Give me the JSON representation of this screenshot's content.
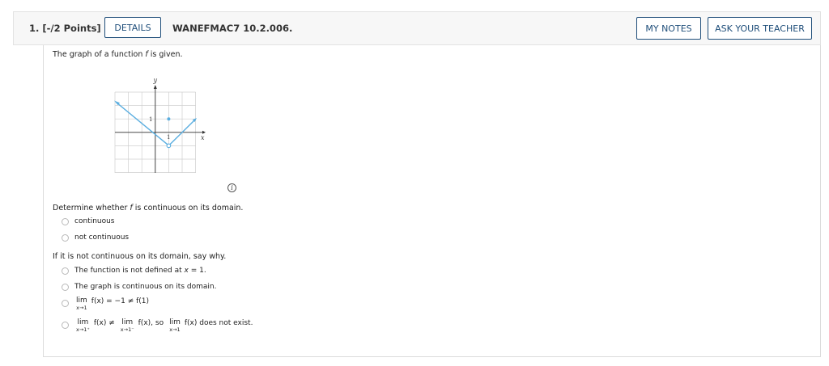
{
  "header": {
    "question_number": "1.  [-/2 Points]",
    "details_label": "DETAILS",
    "question_id": "WANEFMAC7 10.2.006.",
    "my_notes_label": "MY NOTES",
    "ask_teacher_label": "ASK YOUR TEACHER"
  },
  "prompt": {
    "before_f": "The graph of a function ",
    "f": "f",
    "after_f": " is given."
  },
  "graph": {
    "y_axis_label": "y",
    "x_axis_label": "x",
    "tick_y": "1",
    "tick_x": "1",
    "line_color": "#5aaee0"
  },
  "question1": {
    "before_f": "Determine whether ",
    "f": "f",
    "after_f": " is continuous on its domain.",
    "options": [
      "continuous",
      "not continuous"
    ]
  },
  "question2": {
    "text": "If it is not continuous on its domain, say why.",
    "opt1_pre": "The function is not defined at ",
    "opt1_x": "x",
    "opt1_post": " = 1.",
    "opt2": "The graph is continuous on its domain.",
    "opt3_lim": "lim",
    "opt3_sub": "x→1",
    "opt3_rest": "f(x)  =  −1  ≠  f(1)",
    "opt4_lim1": "lim",
    "opt4_sub1": "x→1⁺",
    "opt4_mid1": "f(x)  ≠",
    "opt4_lim2": "lim",
    "opt4_sub2": "x→1⁻",
    "opt4_mid2": "f(x), so",
    "opt4_lim3": "lim",
    "opt4_sub3": "x→1",
    "opt4_end": "f(x) does not exist."
  }
}
